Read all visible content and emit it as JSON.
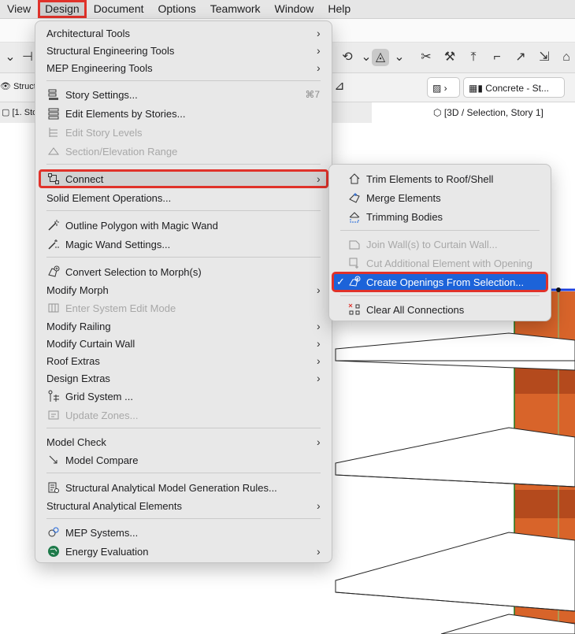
{
  "menubar": {
    "items": [
      "View",
      "Design",
      "Document",
      "Options",
      "Teamwork",
      "Window",
      "Help"
    ],
    "active": "Design"
  },
  "background": {
    "left_partial_label": "Struct",
    "story_tab": "[1. Stor",
    "view_tab": "[3D / Selection, Story 1]",
    "material_label": "Concrete - St...",
    "accent": "#e0322a"
  },
  "design_menu": {
    "architectural_tools": "Architectural Tools",
    "structural_engineering_tools": "Structural Engineering Tools",
    "mep_engineering_tools": "MEP Engineering Tools",
    "story_settings": "Story Settings...",
    "story_settings_shortcut": "⌘7",
    "edit_elements_by_stories": "Edit Elements by Stories...",
    "edit_story_levels": "Edit Story Levels",
    "section_elevation_range": "Section/Elevation Range",
    "connect": "Connect",
    "solid_element_operations": "Solid Element Operations...",
    "outline_polygon": "Outline Polygon with Magic Wand",
    "magic_wand_settings": "Magic Wand Settings...",
    "convert_selection_morph": "Convert Selection to Morph(s)",
    "modify_morph": "Modify Morph",
    "enter_system_edit_mode": "Enter System Edit Mode",
    "modify_railing": "Modify Railing",
    "modify_curtain_wall": "Modify Curtain Wall",
    "roof_extras": "Roof Extras",
    "design_extras": "Design Extras",
    "grid_system": "Grid System ...",
    "update_zones": "Update Zones...",
    "model_check": "Model Check",
    "model_compare": "Model Compare",
    "structural_analytical_rules": "Structural Analytical Model Generation Rules...",
    "structural_analytical_elements": "Structural Analytical Elements",
    "mep_systems": "MEP Systems...",
    "energy_evaluation": "Energy Evaluation"
  },
  "connect_submenu": {
    "trim_to_roof": "Trim Elements to Roof/Shell",
    "merge_elements": "Merge Elements",
    "trimming_bodies": "Trimming Bodies",
    "join_walls_curtain": "Join Wall(s) to Curtain Wall...",
    "cut_additional": "Cut Additional Element with Opening",
    "create_openings": "Create Openings From Selection...",
    "create_openings_check": "✓",
    "clear_connections": "Clear All Connections"
  }
}
